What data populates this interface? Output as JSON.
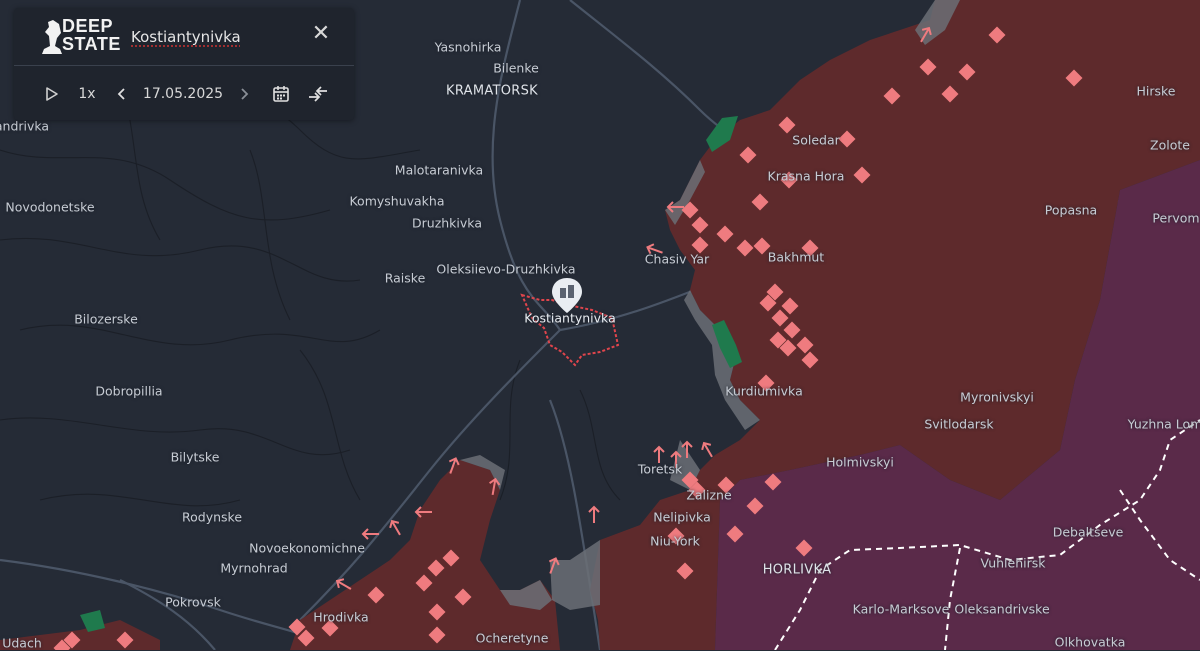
{
  "panel": {
    "logo_text_line1": "DEEP",
    "logo_text_line2": "STATE",
    "place_name": "Kostiantynivka",
    "close_icon": "close-icon",
    "play_icon": "play-icon",
    "speed": "1x",
    "prev_icon": "chevron-left-icon",
    "date": "17.05.2025",
    "next_icon": "chevron-right-icon",
    "calendar_icon": "calendar-icon",
    "compare_icon": "compare-arrows-icon"
  },
  "colors": {
    "background": "#252b36",
    "occupied": "#5e2a2c",
    "occupied_before_2022": "#5a2a49",
    "contested": "#6b6f76",
    "liberated": "#1f7a4d",
    "marker": "#ef7b7f",
    "border_line": "#ffffff"
  },
  "labels": [
    {
      "id": "yasnohirka",
      "text": "Yasnohirka"
    },
    {
      "id": "bilenke",
      "text": "Bilenke"
    },
    {
      "id": "kramatorsk",
      "text": "KRAMATORSK"
    },
    {
      "id": "andrivka",
      "text": "andrivka"
    },
    {
      "id": "malotaranivka",
      "text": "Malotaranivka"
    },
    {
      "id": "komyshuvakha",
      "text": "Komyshuvakha"
    },
    {
      "id": "novodonetske",
      "text": "Novodonetske"
    },
    {
      "id": "druzhkivka",
      "text": "Druzhkivka"
    },
    {
      "id": "raiske",
      "text": "Raiske"
    },
    {
      "id": "oleksiievo",
      "text": "Oleksiievo-Druzhkivka"
    },
    {
      "id": "kostiantynivka",
      "text": "Kostiantynivka"
    },
    {
      "id": "bilozerske",
      "text": "Bilozerske"
    },
    {
      "id": "dobropillia",
      "text": "Dobropillia"
    },
    {
      "id": "bilytske",
      "text": "Bilytske"
    },
    {
      "id": "rodynske",
      "text": "Rodynske"
    },
    {
      "id": "novoekonomichne",
      "text": "Novoekonomichne"
    },
    {
      "id": "myrnohrad",
      "text": "Myrnohrad"
    },
    {
      "id": "pokrovsk",
      "text": "Pokrovsk"
    },
    {
      "id": "udach",
      "text": "Udach"
    },
    {
      "id": "hrodivka",
      "text": "Hrodivka"
    },
    {
      "id": "ocheretyne",
      "text": "Ocheretyne"
    },
    {
      "id": "soledar",
      "text": "Soledar"
    },
    {
      "id": "krasna_hora",
      "text": "Krasna Hora"
    },
    {
      "id": "chasiv_yar",
      "text": "Chasiv Yar"
    },
    {
      "id": "bakhmut",
      "text": "Bakhmut"
    },
    {
      "id": "kurdiumivka",
      "text": "Kurdiumivka"
    },
    {
      "id": "toretsk",
      "text": "Toretsk"
    },
    {
      "id": "zalizne",
      "text": "Zalizne"
    },
    {
      "id": "nelipivka",
      "text": "Nelipivka"
    },
    {
      "id": "niu_york",
      "text": "Niu-York"
    },
    {
      "id": "horlivka",
      "text": "HORLIVKA"
    },
    {
      "id": "holmivskyi",
      "text": "Holmivskyi"
    },
    {
      "id": "svitlodarsk",
      "text": "Svitlodarsk"
    },
    {
      "id": "myronivskyi",
      "text": "Myronivskyi"
    },
    {
      "id": "popasna",
      "text": "Popasna"
    },
    {
      "id": "hirske",
      "text": "Hirske"
    },
    {
      "id": "zolote",
      "text": "Zolote"
    },
    {
      "id": "pervom",
      "text": "Pervom"
    },
    {
      "id": "yuzhna_lom",
      "text": "Yuzhna Lom"
    },
    {
      "id": "debaltseve",
      "text": "Debaltseve"
    },
    {
      "id": "vuhlehirsk",
      "text": "Vuhlehirsk"
    },
    {
      "id": "karlo_markove",
      "text": "Karlo-Marksove"
    },
    {
      "id": "oleksandrivske",
      "text": "Oleksandrivske"
    },
    {
      "id": "olkhovatka",
      "text": "Olkhovatka"
    }
  ]
}
